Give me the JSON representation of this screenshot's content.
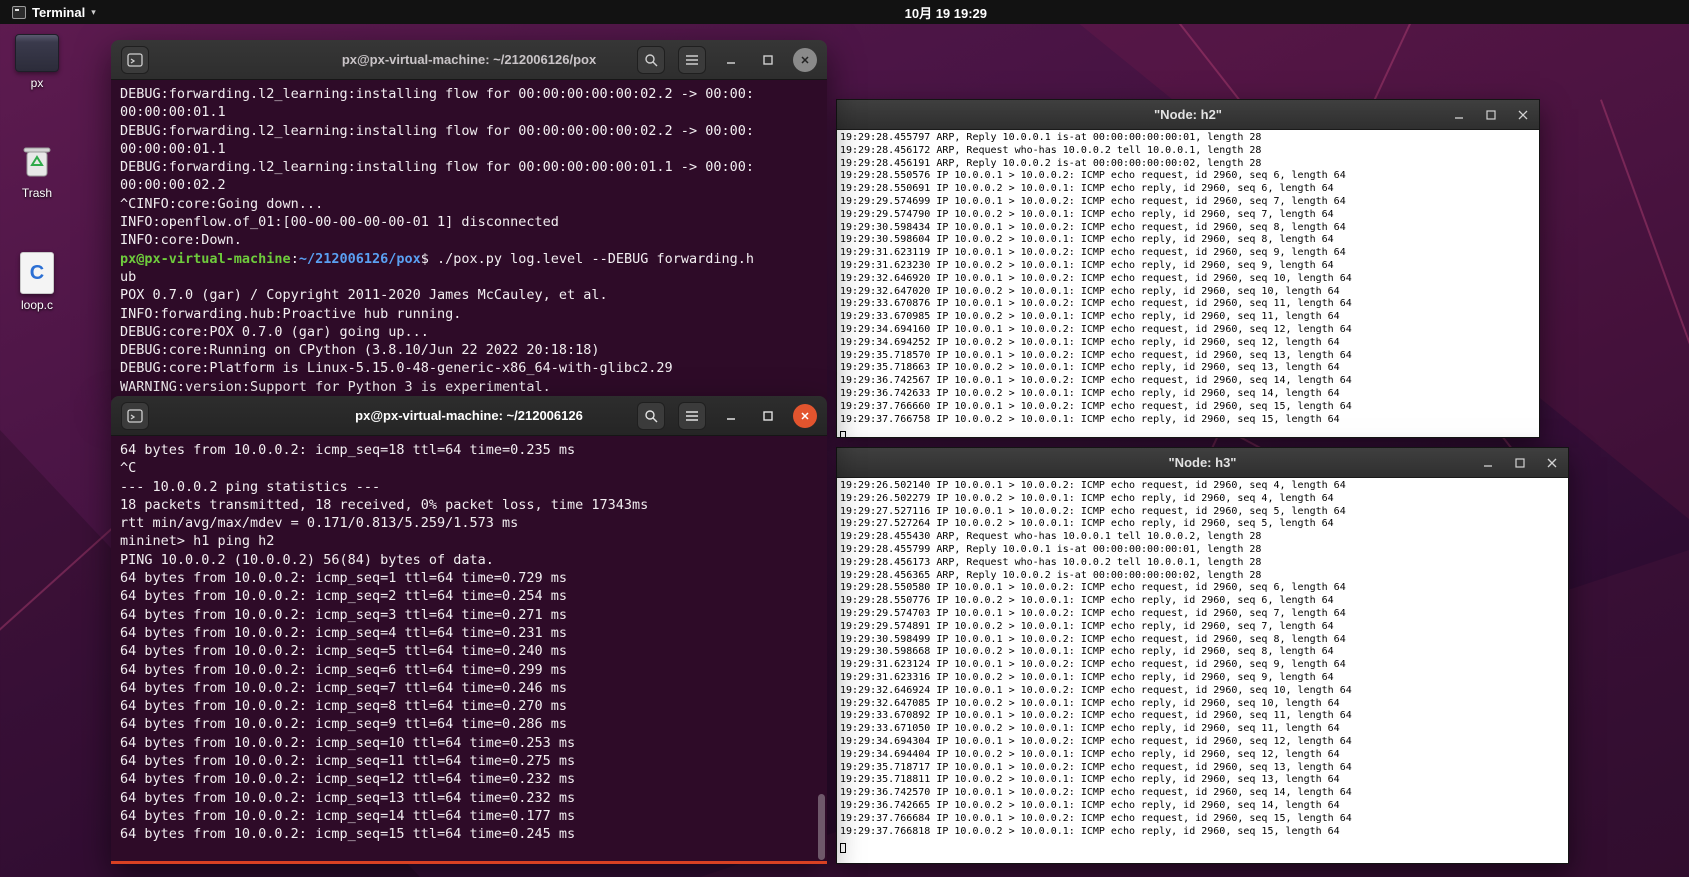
{
  "topbar": {
    "app_menu_label": "Terminal",
    "app_menu_caret": "▾",
    "clock": "10月 19 19:29"
  },
  "desktop": {
    "icons": [
      {
        "label": "px"
      },
      {
        "label": "Trash"
      },
      {
        "label": "loop.c",
        "icon_letter": "C"
      }
    ]
  },
  "colors": {
    "prompt_user_green": "#6ecb3c",
    "prompt_path_blue": "#5aa0f2",
    "focused_close_orange": "#e2542e",
    "window_accent_border": "#d84123",
    "terminal_background": "#2e0b28"
  },
  "windows": {
    "pox": {
      "title": "px@px-virtual-machine: ~/212006126/pox",
      "lines_before_prompt": [
        "DEBUG:forwarding.l2_learning:installing flow for 00:00:00:00:00:02.2 -> 00:00:",
        "00:00:00:01.1",
        "DEBUG:forwarding.l2_learning:installing flow for 00:00:00:00:00:02.2 -> 00:00:",
        "00:00:00:01.1",
        "DEBUG:forwarding.l2_learning:installing flow for 00:00:00:00:00:01.1 -> 00:00:",
        "00:00:00:02.2",
        "^CINFO:core:Going down...",
        "INFO:openflow.of_01:[00-00-00-00-00-01 1] disconnected",
        "INFO:core:Down."
      ],
      "prompt": {
        "user": "px@px-virtual-machine",
        "separator": ":",
        "path": "~/212006126/pox",
        "suffix": "$ ",
        "command": "./pox.py log.level --DEBUG forwarding.h"
      },
      "lines_after_prompt": [
        "ub",
        "POX 0.7.0 (gar) / Copyright 2011-2020 James McCauley, et al.",
        "INFO:forwarding.hub:Proactive hub running.",
        "DEBUG:core:POX 0.7.0 (gar) going up...",
        "DEBUG:core:Running on CPython (3.8.10/Jun 22 2022 20:18:18)",
        "DEBUG:core:Platform is Linux-5.15.0-48-generic-x86_64-with-glibc2.29",
        "WARNING:version:Support for Python 3 is experimental."
      ]
    },
    "mininet": {
      "title": "px@px-virtual-machine: ~/212006126",
      "lines": [
        "64 bytes from 10.0.0.2: icmp_seq=18 ttl=64 time=0.235 ms",
        "^C",
        "--- 10.0.0.2 ping statistics ---",
        "18 packets transmitted, 18 received, 0% packet loss, time 17343ms",
        "rtt min/avg/max/mdev = 0.171/0.813/5.259/1.573 ms",
        "mininet> h1 ping h2",
        "PING 10.0.0.2 (10.0.0.2) 56(84) bytes of data.",
        "64 bytes from 10.0.0.2: icmp_seq=1 ttl=64 time=0.729 ms",
        "64 bytes from 10.0.0.2: icmp_seq=2 ttl=64 time=0.254 ms",
        "64 bytes from 10.0.0.2: icmp_seq=3 ttl=64 time=0.271 ms",
        "64 bytes from 10.0.0.2: icmp_seq=4 ttl=64 time=0.231 ms",
        "64 bytes from 10.0.0.2: icmp_seq=5 ttl=64 time=0.240 ms",
        "64 bytes from 10.0.0.2: icmp_seq=6 ttl=64 time=0.299 ms",
        "64 bytes from 10.0.0.2: icmp_seq=7 ttl=64 time=0.246 ms",
        "64 bytes from 10.0.0.2: icmp_seq=8 ttl=64 time=0.270 ms",
        "64 bytes from 10.0.0.2: icmp_seq=9 ttl=64 time=0.286 ms",
        "64 bytes from 10.0.0.2: icmp_seq=10 ttl=64 time=0.253 ms",
        "64 bytes from 10.0.0.2: icmp_seq=11 ttl=64 time=0.275 ms",
        "64 bytes from 10.0.0.2: icmp_seq=12 ttl=64 time=0.232 ms",
        "64 bytes from 10.0.0.2: icmp_seq=13 ttl=64 time=0.232 ms",
        "64 bytes from 10.0.0.2: icmp_seq=14 ttl=64 time=0.177 ms",
        "64 bytes from 10.0.0.2: icmp_seq=15 ttl=64 time=0.245 ms"
      ]
    },
    "h2": {
      "title": "\"Node: h2\"",
      "lines": [
        "19:29:28.455797 ARP, Reply 10.0.0.1 is-at 00:00:00:00:00:01, length 28",
        "19:29:28.456172 ARP, Request who-has 10.0.0.2 tell 10.0.0.1, length 28",
        "19:29:28.456191 ARP, Reply 10.0.0.2 is-at 00:00:00:00:00:02, length 28",
        "19:29:28.550576 IP 10.0.0.1 > 10.0.0.2: ICMP echo request, id 2960, seq 6, length 64",
        "19:29:28.550691 IP 10.0.0.2 > 10.0.0.1: ICMP echo reply, id 2960, seq 6, length 64",
        "19:29:29.574699 IP 10.0.0.1 > 10.0.0.2: ICMP echo request, id 2960, seq 7, length 64",
        "19:29:29.574790 IP 10.0.0.2 > 10.0.0.1: ICMP echo reply, id 2960, seq 7, length 64",
        "19:29:30.598434 IP 10.0.0.1 > 10.0.0.2: ICMP echo request, id 2960, seq 8, length 64",
        "19:29:30.598604 IP 10.0.0.2 > 10.0.0.1: ICMP echo reply, id 2960, seq 8, length 64",
        "19:29:31.623119 IP 10.0.0.1 > 10.0.0.2: ICMP echo request, id 2960, seq 9, length 64",
        "19:29:31.623230 IP 10.0.0.2 > 10.0.0.1: ICMP echo reply, id 2960, seq 9, length 64",
        "19:29:32.646920 IP 10.0.0.1 > 10.0.0.2: ICMP echo request, id 2960, seq 10, length 64",
        "19:29:32.647020 IP 10.0.0.2 > 10.0.0.1: ICMP echo reply, id 2960, seq 10, length 64",
        "19:29:33.670876 IP 10.0.0.1 > 10.0.0.2: ICMP echo request, id 2960, seq 11, length 64",
        "19:29:33.670985 IP 10.0.0.2 > 10.0.0.1: ICMP echo reply, id 2960, seq 11, length 64",
        "19:29:34.694160 IP 10.0.0.1 > 10.0.0.2: ICMP echo request, id 2960, seq 12, length 64",
        "19:29:34.694252 IP 10.0.0.2 > 10.0.0.1: ICMP echo reply, id 2960, seq 12, length 64",
        "19:29:35.718570 IP 10.0.0.1 > 10.0.0.2: ICMP echo request, id 2960, seq 13, length 64",
        "19:29:35.718663 IP 10.0.0.2 > 10.0.0.1: ICMP echo reply, id 2960, seq 13, length 64",
        "19:29:36.742567 IP 10.0.0.1 > 10.0.0.2: ICMP echo request, id 2960, seq 14, length 64",
        "19:29:36.742633 IP 10.0.0.2 > 10.0.0.1: ICMP echo reply, id 2960, seq 14, length 64",
        "19:29:37.766660 IP 10.0.0.1 > 10.0.0.2: ICMP echo request, id 2960, seq 15, length 64",
        "19:29:37.766758 IP 10.0.0.2 > 10.0.0.1: ICMP echo reply, id 2960, seq 15, length 64"
      ]
    },
    "h3": {
      "title": "\"Node: h3\"",
      "lines": [
        "19:29:26.502140 IP 10.0.0.1 > 10.0.0.2: ICMP echo request, id 2960, seq 4, length 64",
        "19:29:26.502279 IP 10.0.0.2 > 10.0.0.1: ICMP echo reply, id 2960, seq 4, length 64",
        "19:29:27.527116 IP 10.0.0.1 > 10.0.0.2: ICMP echo request, id 2960, seq 5, length 64",
        "19:29:27.527264 IP 10.0.0.2 > 10.0.0.1: ICMP echo reply, id 2960, seq 5, length 64",
        "19:29:28.455430 ARP, Request who-has 10.0.0.1 tell 10.0.0.2, length 28",
        "19:29:28.455799 ARP, Reply 10.0.0.1 is-at 00:00:00:00:00:01, length 28",
        "19:29:28.456173 ARP, Request who-has 10.0.0.2 tell 10.0.0.1, length 28",
        "19:29:28.456365 ARP, Reply 10.0.0.2 is-at 00:00:00:00:00:02, length 28",
        "19:29:28.550580 IP 10.0.0.1 > 10.0.0.2: ICMP echo request, id 2960, seq 6, length 64",
        "19:29:28.550776 IP 10.0.0.2 > 10.0.0.1: ICMP echo reply, id 2960, seq 6, length 64",
        "19:29:29.574703 IP 10.0.0.1 > 10.0.0.2: ICMP echo request, id 2960, seq 7, length 64",
        "19:29:29.574891 IP 10.0.0.2 > 10.0.0.1: ICMP echo reply, id 2960, seq 7, length 64",
        "19:29:30.598499 IP 10.0.0.1 > 10.0.0.2: ICMP echo request, id 2960, seq 8, length 64",
        "19:29:30.598668 IP 10.0.0.2 > 10.0.0.1: ICMP echo reply, id 2960, seq 8, length 64",
        "19:29:31.623124 IP 10.0.0.1 > 10.0.0.2: ICMP echo request, id 2960, seq 9, length 64",
        "19:29:31.623316 IP 10.0.0.2 > 10.0.0.1: ICMP echo reply, id 2960, seq 9, length 64",
        "19:29:32.646924 IP 10.0.0.1 > 10.0.0.2: ICMP echo request, id 2960, seq 10, length 64",
        "19:29:32.647085 IP 10.0.0.2 > 10.0.0.1: ICMP echo reply, id 2960, seq 10, length 64",
        "19:29:33.670892 IP 10.0.0.1 > 10.0.0.2: ICMP echo request, id 2960, seq 11, length 64",
        "19:29:33.671050 IP 10.0.0.2 > 10.0.0.1: ICMP echo reply, id 2960, seq 11, length 64",
        "19:29:34.694304 IP 10.0.0.1 > 10.0.0.2: ICMP echo request, id 2960, seq 12, length 64",
        "19:29:34.694404 IP 10.0.0.2 > 10.0.0.1: ICMP echo reply, id 2960, seq 12, length 64",
        "19:29:35.718717 IP 10.0.0.1 > 10.0.0.2: ICMP echo request, id 2960, seq 13, length 64",
        "19:29:35.718811 IP 10.0.0.2 > 10.0.0.1: ICMP echo reply, id 2960, seq 13, length 64",
        "19:29:36.742570 IP 10.0.0.1 > 10.0.0.2: ICMP echo request, id 2960, seq 14, length 64",
        "19:29:36.742665 IP 10.0.0.2 > 10.0.0.1: ICMP echo reply, id 2960, seq 14, length 64",
        "19:29:37.766684 IP 10.0.0.1 > 10.0.0.2: ICMP echo request, id 2960, seq 15, length 64",
        "19:29:37.766818 IP 10.0.0.2 > 10.0.0.1: ICMP echo reply, id 2960, seq 15, length 64"
      ]
    }
  }
}
